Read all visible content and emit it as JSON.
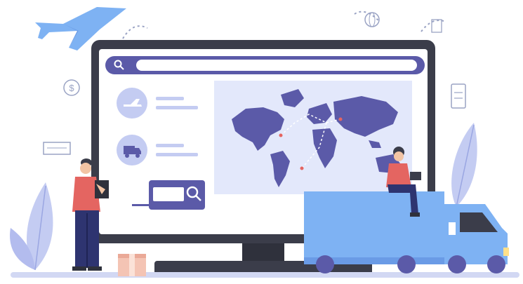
{
  "illustration": {
    "decor_icons": [
      "airplane-icon",
      "dollar-icon",
      "cash-icon",
      "clipboard-icon",
      "globe-icon",
      "document-icon"
    ],
    "monitor": {
      "search_bar": {
        "icon": "search-icon",
        "value": ""
      },
      "left_panel": [
        {
          "icon": "airplane-icon"
        },
        {
          "icon": "truck-icon"
        }
      ],
      "search_button_icon": "magnifier-icon",
      "map": {
        "icon": "world-map"
      }
    },
    "people": [
      "person-with-tablet",
      "person-sitting-on-truck"
    ],
    "vehicle": "delivery-truck",
    "package": "cardboard-box"
  },
  "colors": {
    "primary": "#5b5aa8",
    "light_panel": "#e3e8fb",
    "monitor_frame": "#3b3d4a",
    "truck": "#7eb2f3",
    "person_shirt": "#e46561",
    "leaf": "#c4ccf2",
    "ground": "#d2d8f3"
  }
}
